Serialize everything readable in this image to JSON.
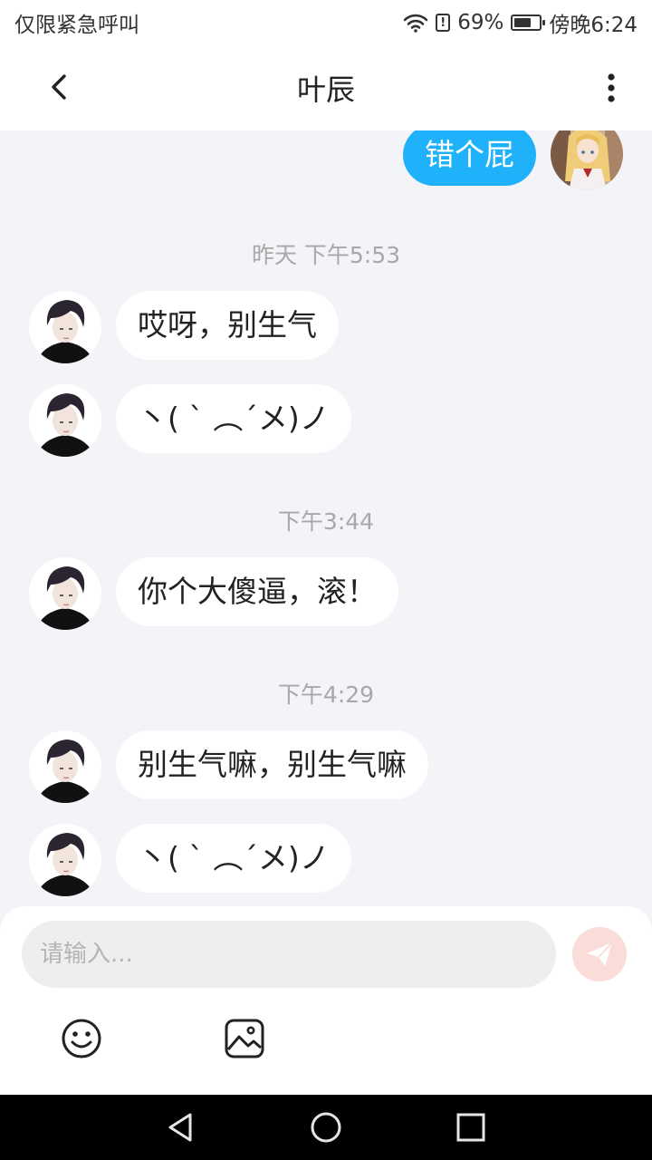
{
  "status_bar": {
    "carrier": "仅限紧急呼叫",
    "battery": "69%",
    "battery_level": 0.69,
    "time": "傍晚6:24"
  },
  "header": {
    "title": "叶辰"
  },
  "messages": {
    "out_1": "错个屁",
    "ts_1": "昨天 下午5:53",
    "in_1": "哎呀，别生气",
    "in_2": "丶( ` ︵´メ)ノ",
    "ts_2": "下午3:44",
    "in_3": "你个大傻逼，滚！",
    "ts_3": "下午4:29",
    "in_4": "别生气嘛，别生气嘛",
    "in_5": "丶( ` ︵´メ)ノ"
  },
  "input": {
    "placeholder": "请输入..."
  },
  "icons": {
    "back": "chevron-left-icon",
    "more": "more-vertical-icon",
    "send": "send-icon",
    "emoji": "emoji-icon",
    "image": "image-icon",
    "nav_back": "triangle-back-icon",
    "nav_home": "circle-home-icon",
    "nav_recents": "square-recents-icon"
  },
  "colors": {
    "outgoing_bubble": "#1fb1f9",
    "incoming_bubble": "#ffffff",
    "chat_background": "#f3f4f7",
    "send_button": "#fadcd8"
  }
}
